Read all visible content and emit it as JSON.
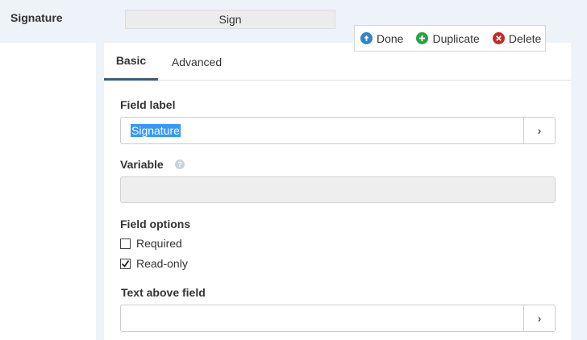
{
  "field": {
    "title": "Signature",
    "preview_text": "Sign"
  },
  "actions": [
    {
      "label": "Done",
      "icon": "arrow-up-circle-icon",
      "color": "#2e86c8"
    },
    {
      "label": "Duplicate",
      "icon": "plus-circle-icon",
      "color": "#27a243"
    },
    {
      "label": "Delete",
      "icon": "x-circle-icon",
      "color": "#c52a2a"
    }
  ],
  "tabs": [
    {
      "label": "Basic",
      "active": true
    },
    {
      "label": "Advanced",
      "active": false
    }
  ],
  "form": {
    "field_label": {
      "label": "Field label",
      "value": "Signature"
    },
    "variable": {
      "label": "Variable",
      "value": ""
    },
    "field_options": {
      "label": "Field options",
      "options": [
        {
          "label": "Required",
          "checked": false
        },
        {
          "label": "Read-only",
          "checked": true
        }
      ]
    },
    "text_above": {
      "label": "Text above field",
      "value": ""
    }
  },
  "colors": {
    "panel_bg": "#eef3f9",
    "tab_underline": "#3d5a75",
    "selection": "#3399ff"
  }
}
